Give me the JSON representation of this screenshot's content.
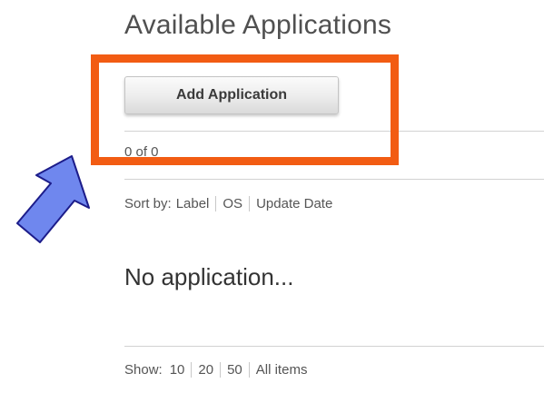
{
  "header": {
    "title": "Available Applications"
  },
  "toolbar": {
    "add_label": "Add Application"
  },
  "list": {
    "count_text": "0 of 0",
    "sort": {
      "label": "Sort by:",
      "options": [
        "Label",
        "OS",
        "Update Date"
      ]
    },
    "empty_message": "No application...",
    "show": {
      "label": "Show:",
      "options": [
        "10",
        "20",
        "50",
        "All items"
      ]
    }
  },
  "annotations": {
    "highlight_color": "#f25c13",
    "arrow_color": "#6f87ee"
  }
}
